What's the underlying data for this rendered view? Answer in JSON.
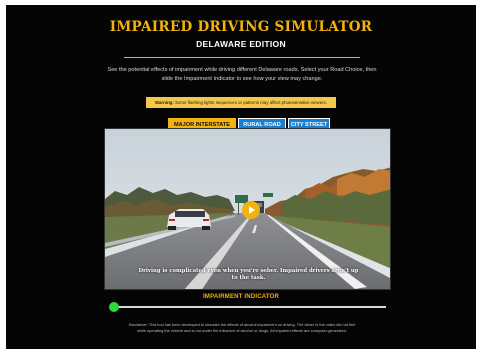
{
  "header": {
    "title": "IMPAIRED DRIVING SIMULATOR",
    "subtitle": "DELAWARE EDITION"
  },
  "intro_text": "See the potential effects of impairment while driving different Delaware roads. Select your Road Choice, then slide the Impairment Indicator to see how your view may change.",
  "warning": {
    "label": "Warning:",
    "text": "Some flashing lights sequences or patterns may affect photosensitive viewers."
  },
  "tabs": [
    {
      "label": "MAJOR INTERSTATE",
      "active": true
    },
    {
      "label": "RURAL ROAD",
      "active": false
    },
    {
      "label": "CITY STREET",
      "active": false
    }
  ],
  "video": {
    "caption": "Driving is complicated even when you're sober. Impaired drivers aren't up to the task.",
    "play_icon": "play-icon"
  },
  "impairment_indicator": {
    "label": "IMPAIRMENT INDICATOR",
    "value": 0
  },
  "disclaimer": "Disclaimer: This tool has been developed to simulate the effects of alcohol impairment on driving. The driver in the video did not feel while operating the vehicle and is not under the influence of alcohol or drugs. All impaired effects are computer-generated.",
  "colors": {
    "accent": "#f2b20f",
    "tab_inactive": "#1b7fd0",
    "slider": "#32d83d",
    "background": "#050505"
  }
}
